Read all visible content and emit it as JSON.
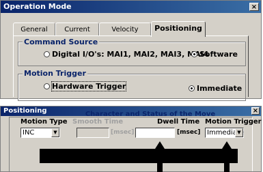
{
  "window1": {
    "title": "Operation Mode",
    "close": "×",
    "tabs": [
      {
        "label": "General"
      },
      {
        "label": "Current"
      },
      {
        "label": "Velocity"
      },
      {
        "label": "Positioning"
      }
    ],
    "command_source": {
      "label": "Command Source",
      "digital_io": "Digital I/O's: MAI1, MAI2, MAI3, MAI4",
      "software": "Software"
    },
    "motion_trigger": {
      "label": "Motion Trigger",
      "hardware": "Hardware Trigger",
      "immediate": "Immediate"
    }
  },
  "window2": {
    "title": "Positioning",
    "close": "×",
    "heading": "Character and Status of the Move",
    "motion_type_label": "Motion Type",
    "motion_type_value": "INC",
    "smooth_time_label": "Smooth Time",
    "smooth_time_unit": "[msec]",
    "dwell_time_label": "Dwell Time",
    "dwell_time_unit": "[msec]",
    "motion_trigger_label": "Motion Trigger",
    "motion_trigger_value": "Immediate"
  },
  "colors": {
    "title_bar": "#0a246a",
    "face": "#d4d0c8",
    "group_label": "#0a246a"
  }
}
